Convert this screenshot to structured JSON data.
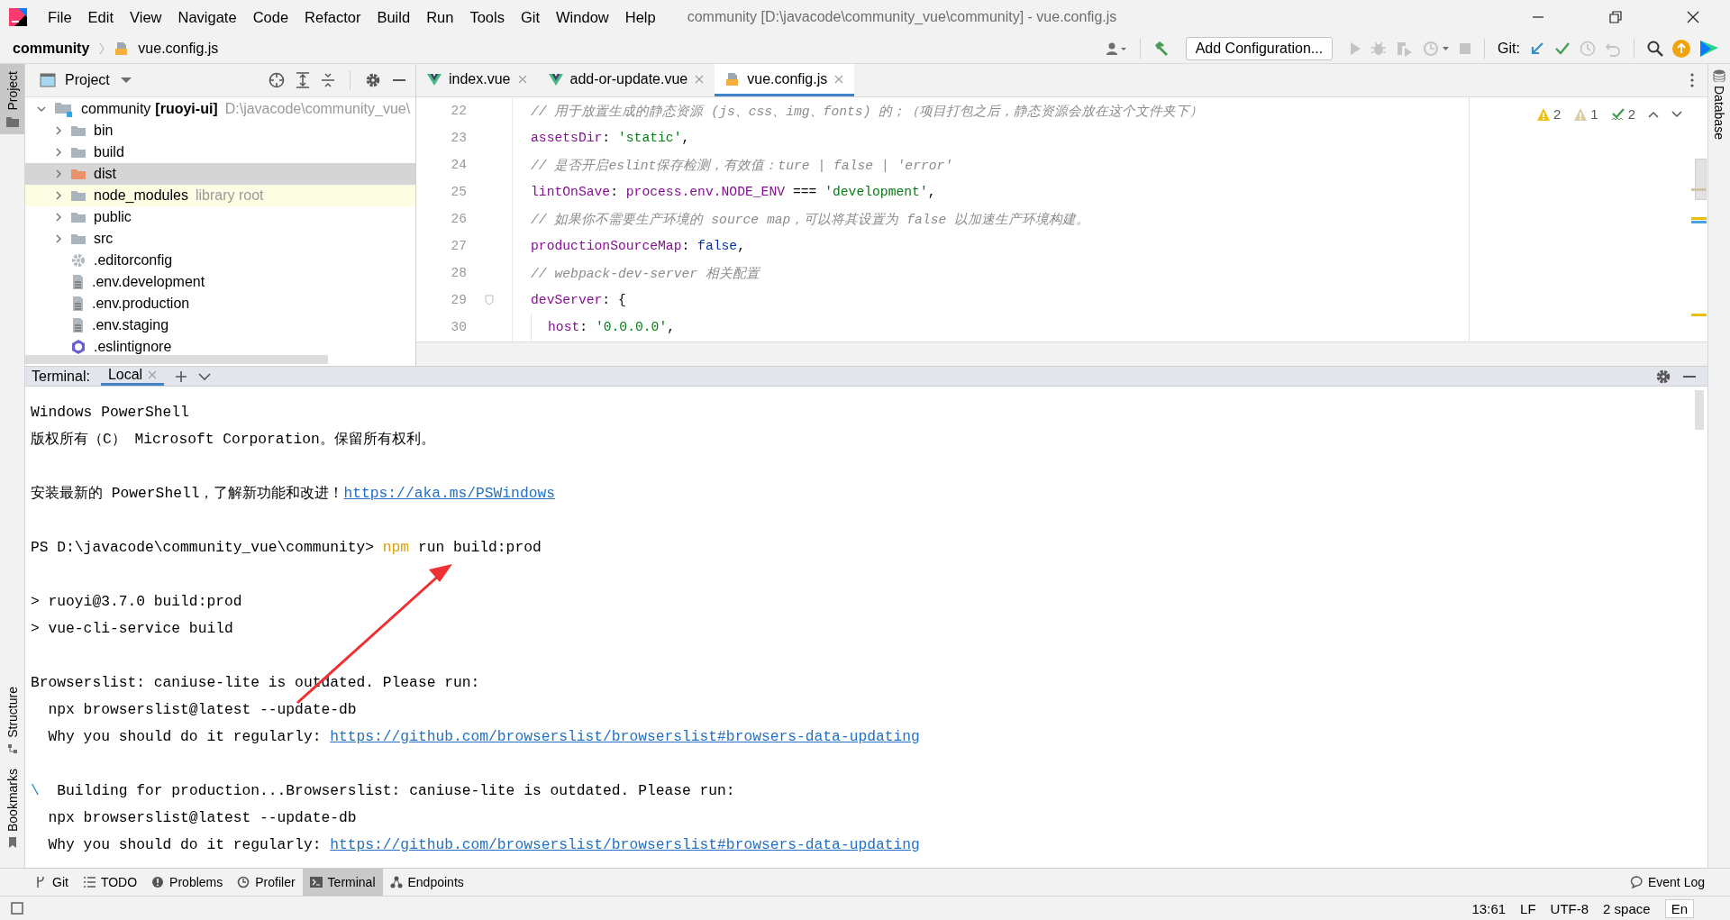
{
  "window": {
    "title": "community [D:\\javacode\\community_vue\\community] - vue.config.js"
  },
  "menu_bar": {
    "items": [
      "File",
      "Edit",
      "View",
      "Navigate",
      "Code",
      "Refactor",
      "Build",
      "Run",
      "Tools",
      "Git",
      "Window",
      "Help"
    ]
  },
  "navigation_bar": {
    "breadcrumbs": [
      {
        "label": "community",
        "kind": "project"
      },
      {
        "label": "vue.config.js",
        "kind": "js"
      }
    ]
  },
  "toolbar": {
    "run_configuration": "Add Configuration...",
    "git_label": "Git:"
  },
  "left_stripe": {
    "top": [
      {
        "label": "Project",
        "selected": true
      }
    ],
    "bottom": [
      {
        "label": "Structure",
        "selected": false
      },
      {
        "label": "Bookmarks",
        "selected": false
      }
    ]
  },
  "right_stripe": {
    "items": [
      {
        "label": "Database",
        "selected": false
      }
    ]
  },
  "project_panel": {
    "title": "Project",
    "tree": [
      {
        "label": "community",
        "tag": "[ruoyi-ui]",
        "path": "D:\\javacode\\community_vue\\",
        "kind": "module",
        "expanded": true,
        "selected": false,
        "children": [
          {
            "label": "bin",
            "kind": "folder",
            "expanded": false,
            "selected": false
          },
          {
            "label": "build",
            "kind": "folder",
            "expanded": false,
            "selected": false
          },
          {
            "label": "dist",
            "kind": "excluded_folder",
            "expanded": false,
            "selected": true
          },
          {
            "label": "node_modules",
            "hint": "library root",
            "kind": "library_folder",
            "expanded": false,
            "selected": false
          },
          {
            "label": "public",
            "kind": "folder",
            "expanded": false,
            "selected": false
          },
          {
            "label": "src",
            "kind": "folder",
            "expanded": false,
            "selected": false
          },
          {
            "label": ".editorconfig",
            "kind": "config_file",
            "selected": false
          },
          {
            "label": ".env.development",
            "kind": "text_file",
            "selected": false
          },
          {
            "label": ".env.production",
            "kind": "text_file",
            "selected": false
          },
          {
            "label": ".env.staging",
            "kind": "text_file",
            "selected": false
          },
          {
            "label": ".eslintignore",
            "kind": "eslint_file",
            "selected": false
          }
        ]
      }
    ]
  },
  "editor": {
    "tabs": [
      {
        "label": "index.vue",
        "kind": "vue",
        "selected": false
      },
      {
        "label": "add-or-update.vue",
        "kind": "vue",
        "selected": false
      },
      {
        "label": "vue.config.js",
        "kind": "js",
        "selected": true
      }
    ],
    "inspections": [
      {
        "kind": "warning",
        "count": "2"
      },
      {
        "kind": "weak_warning",
        "count": "1"
      },
      {
        "kind": "typo",
        "count": "2"
      }
    ],
    "lines": [
      {
        "number": "22",
        "indent": false,
        "foldable": false,
        "tokens": [
          {
            "kind": "comment",
            "text": "// 用于放置生成的静态资源 (js、css、img、fonts) 的；（项目打包之后，静态资源会放在这个文件夹下）"
          }
        ]
      },
      {
        "number": "23",
        "indent": false,
        "foldable": false,
        "tokens": [
          {
            "kind": "key",
            "text": "assetsDir"
          },
          {
            "kind": "plain",
            "text": ": "
          },
          {
            "kind": "string",
            "text": "'static'"
          },
          {
            "kind": "plain",
            "text": ","
          }
        ]
      },
      {
        "number": "24",
        "indent": false,
        "foldable": false,
        "tokens": [
          {
            "kind": "comment",
            "text": "// 是否开启eslint保存检测，有效值：ture | false | 'error'"
          }
        ]
      },
      {
        "number": "25",
        "indent": false,
        "foldable": false,
        "tokens": [
          {
            "kind": "key",
            "text": "lintOnSave"
          },
          {
            "kind": "plain",
            "text": ": "
          },
          {
            "kind": "key",
            "text": "process.env.NODE_ENV"
          },
          {
            "kind": "plain",
            "text": " === "
          },
          {
            "kind": "string",
            "text": "'development'"
          },
          {
            "kind": "plain",
            "text": ","
          }
        ]
      },
      {
        "number": "26",
        "indent": false,
        "foldable": false,
        "tokens": [
          {
            "kind": "comment",
            "text": "// 如果你不需要生产环境的 source map，可以将其设置为 false 以加速生产环境构建。"
          }
        ]
      },
      {
        "number": "27",
        "indent": false,
        "foldable": false,
        "tokens": [
          {
            "kind": "key",
            "text": "productionSourceMap"
          },
          {
            "kind": "plain",
            "text": ": "
          },
          {
            "kind": "keyword",
            "text": "false"
          },
          {
            "kind": "plain",
            "text": ","
          }
        ]
      },
      {
        "number": "28",
        "indent": false,
        "foldable": false,
        "tokens": [
          {
            "kind": "comment",
            "text": "// webpack-dev-server 相关配置"
          }
        ]
      },
      {
        "number": "29",
        "indent": false,
        "foldable": true,
        "tokens": [
          {
            "kind": "key",
            "text": "devServer"
          },
          {
            "kind": "plain",
            "text": ": {"
          }
        ]
      },
      {
        "number": "30",
        "indent": true,
        "foldable": false,
        "tokens": [
          {
            "kind": "key",
            "text": "host"
          },
          {
            "kind": "plain",
            "text": ": "
          },
          {
            "kind": "string",
            "text": "'0.0.0.0'"
          },
          {
            "kind": "plain",
            "text": ","
          }
        ]
      }
    ]
  },
  "terminal": {
    "label": "Terminal:",
    "tabs": [
      {
        "label": "Local",
        "selected": true
      }
    ],
    "blocks": [
      [
        [
          {
            "kind": "plain",
            "text": "Windows PowerShell"
          }
        ],
        [
          {
            "kind": "plain",
            "text": "版权所有（C） Microsoft Corporation。保留所有权利。"
          }
        ]
      ],
      [
        [
          {
            "kind": "plain",
            "text": "安装最新的 PowerShell，了解新功能和改进！"
          },
          {
            "kind": "link",
            "text": "https://aka.ms/PSWindows"
          }
        ]
      ],
      [
        [
          {
            "kind": "plain",
            "text": "PS D:\\javacode\\community_vue\\community> "
          },
          {
            "kind": "command",
            "text": "npm"
          },
          {
            "kind": "plain",
            "text": " run build:prod"
          }
        ]
      ],
      [
        [
          {
            "kind": "plain",
            "text": "> ruoyi@3.7.0 build:prod"
          }
        ],
        [
          {
            "kind": "plain",
            "text": "> vue-cli-service build"
          }
        ]
      ],
      [
        [
          {
            "kind": "plain",
            "text": "Browserslist: caniuse-lite is outdated. Please run:"
          }
        ],
        [
          {
            "kind": "plain",
            "text": "  npx browserslist@latest --update-db"
          }
        ],
        [
          {
            "kind": "plain",
            "text": "  Why you should do it regularly: "
          },
          {
            "kind": "link",
            "text": "https://github.com/browserslist/browserslist#browsers-data-updating"
          }
        ]
      ],
      [
        [
          {
            "kind": "spinner",
            "text": "\\"
          },
          {
            "kind": "plain",
            "text": "  Building for production...Browserslist: caniuse-lite is outdated. Please run:"
          }
        ],
        [
          {
            "kind": "plain",
            "text": "  npx browserslist@latest --update-db"
          }
        ],
        [
          {
            "kind": "plain",
            "text": "  Why you should do it regularly: "
          },
          {
            "kind": "link",
            "text": "https://github.com/browserslist/browserslist#browsers-data-updating"
          }
        ]
      ]
    ]
  },
  "tool_window_bar": {
    "items": [
      {
        "label": "Git",
        "kind": "git",
        "selected": false
      },
      {
        "label": "TODO",
        "kind": "todo",
        "selected": false
      },
      {
        "label": "Problems",
        "kind": "problems",
        "selected": false
      },
      {
        "label": "Profiler",
        "kind": "profiler",
        "selected": false
      },
      {
        "label": "Terminal",
        "kind": "terminal",
        "selected": true
      },
      {
        "label": "Endpoints",
        "kind": "endpoints",
        "selected": false
      }
    ],
    "event_log": "Event Log"
  },
  "status_bar": {
    "items": [
      "13:61",
      "LF",
      "UTF-8",
      "2 space"
    ],
    "input_method": "En"
  }
}
